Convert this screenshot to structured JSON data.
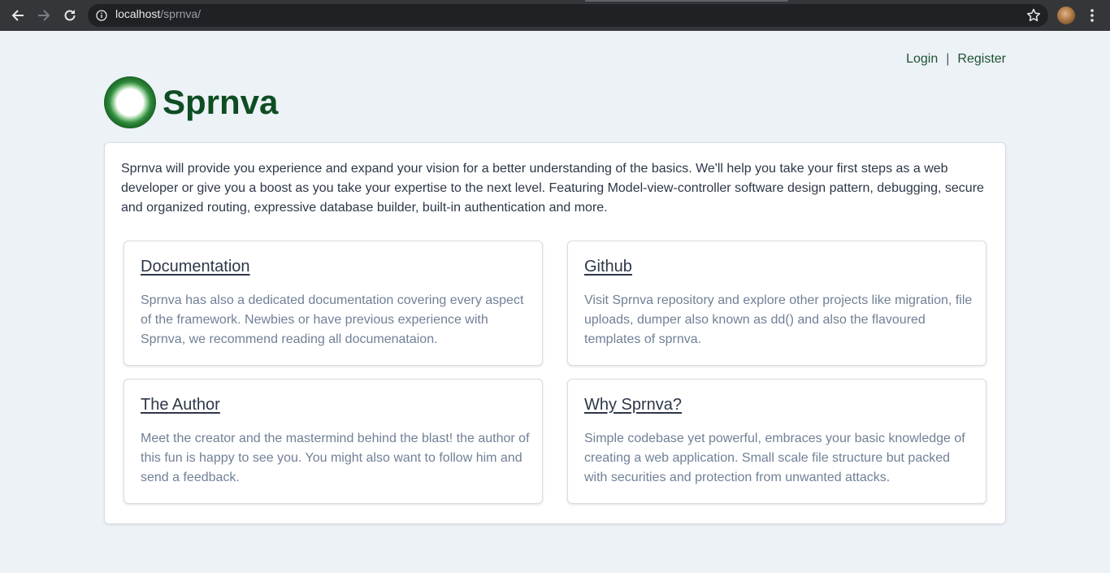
{
  "browser": {
    "url_host": "localhost",
    "url_path": "/sprnva/",
    "icons": [
      "back-icon",
      "forward-icon",
      "reload-icon",
      "info-icon",
      "star-icon",
      "avatar",
      "menu-icon"
    ]
  },
  "auth": {
    "login": "Login",
    "separator": "|",
    "register": "Register"
  },
  "brand": {
    "name": "Sprnva",
    "color": "#0e4d22"
  },
  "intro": "Sprnva will provide you experience and expand your vision for a better understanding of the basics. We'll help you take your first steps as a web developer or give you a boost as you take your expertise to the next level. Featuring Model-view-controller software design pattern, debugging, secure and organized routing, expressive database builder, built-in authentication and more.",
  "features": [
    {
      "title": "Documentation",
      "text": "Sprnva has also a dedicated documentation covering every aspect of the framework. Newbies or have previous experience with Sprnva, we recommend reading all documenataion."
    },
    {
      "title": "Github",
      "text": "Visit Sprnva repository and explore other projects like migration, file uploads, dumper also known as dd() and also the flavoured templates of sprnva."
    },
    {
      "title": "The Author",
      "text": "Meet the creator and the mastermind behind the blast! the author of this fun is happy to see you. You might also want to follow him and send a feedback."
    },
    {
      "title": "Why Sprnva?",
      "text": "Simple codebase yet powerful, embraces your basic knowledge of creating a web application. Small scale file structure but packed with securities and protection from unwanted attacks."
    }
  ]
}
